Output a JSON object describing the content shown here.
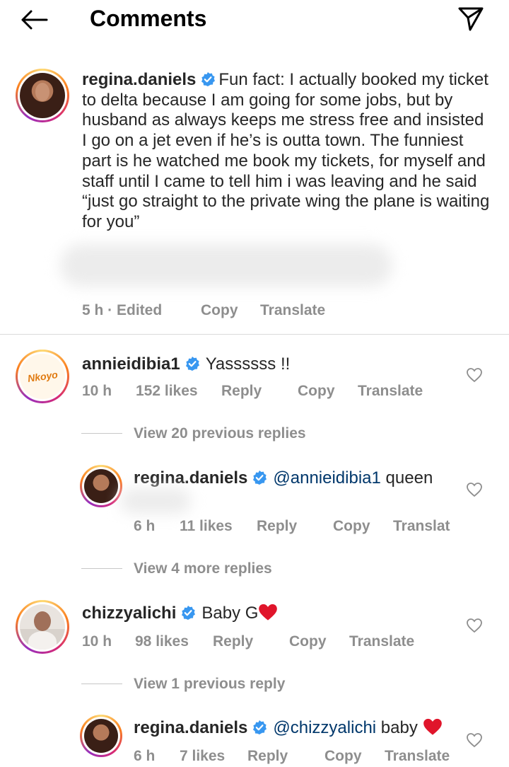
{
  "header": {
    "title": "Comments"
  },
  "caption": {
    "username": "regina.daniels",
    "text": "Fun fact: I actually booked my ticket to delta because I am going for some jobs, but by husband as always keeps me stress free and insisted I go on a jet even if he’s is outta town. The funniest part is he watched me book my tickets, for myself and staff until I came to tell him i was leaving and he said “just go straight to the private wing the plane is waiting for you”",
    "time": "5 h · Edited",
    "copy": "Copy",
    "translate": "Translate"
  },
  "comments": [
    {
      "username": "annieidibia1",
      "text": "Yassssss !!",
      "time": "10 h",
      "likes": "152 likes",
      "reply": "Reply",
      "copy": "Copy",
      "translate": "Translate",
      "avatar_text": "Nkoyo",
      "view_replies": "View 20 previous replies"
    },
    {
      "username": "regina.daniels",
      "mention": "@annieidibia1",
      "text": "queen",
      "time": "6 h",
      "likes": "11 likes",
      "reply": "Reply",
      "copy": "Copy",
      "translate": "Translat",
      "view_replies": "View 4 more replies"
    },
    {
      "username": "chizzyalichi",
      "text": "Baby G",
      "time": "10 h",
      "likes": "98 likes",
      "reply": "Reply",
      "copy": "Copy",
      "translate": "Translate",
      "view_replies": "View 1 previous reply"
    },
    {
      "username": "regina.daniels",
      "mention": "@chizzyalichi",
      "text": "baby",
      "time": "6 h",
      "likes": "7 likes",
      "reply": "Reply",
      "copy": "Copy",
      "translate": "Translate"
    }
  ],
  "colors": {
    "verified": "#3897f0",
    "mention": "#00376b",
    "heart_emoji": "#e0152b",
    "meta": "#8e8e8e"
  },
  "icons": [
    "back-arrow-icon",
    "send-icon",
    "verified-badge-icon",
    "heart-icon",
    "red-heart-emoji-icon"
  ]
}
